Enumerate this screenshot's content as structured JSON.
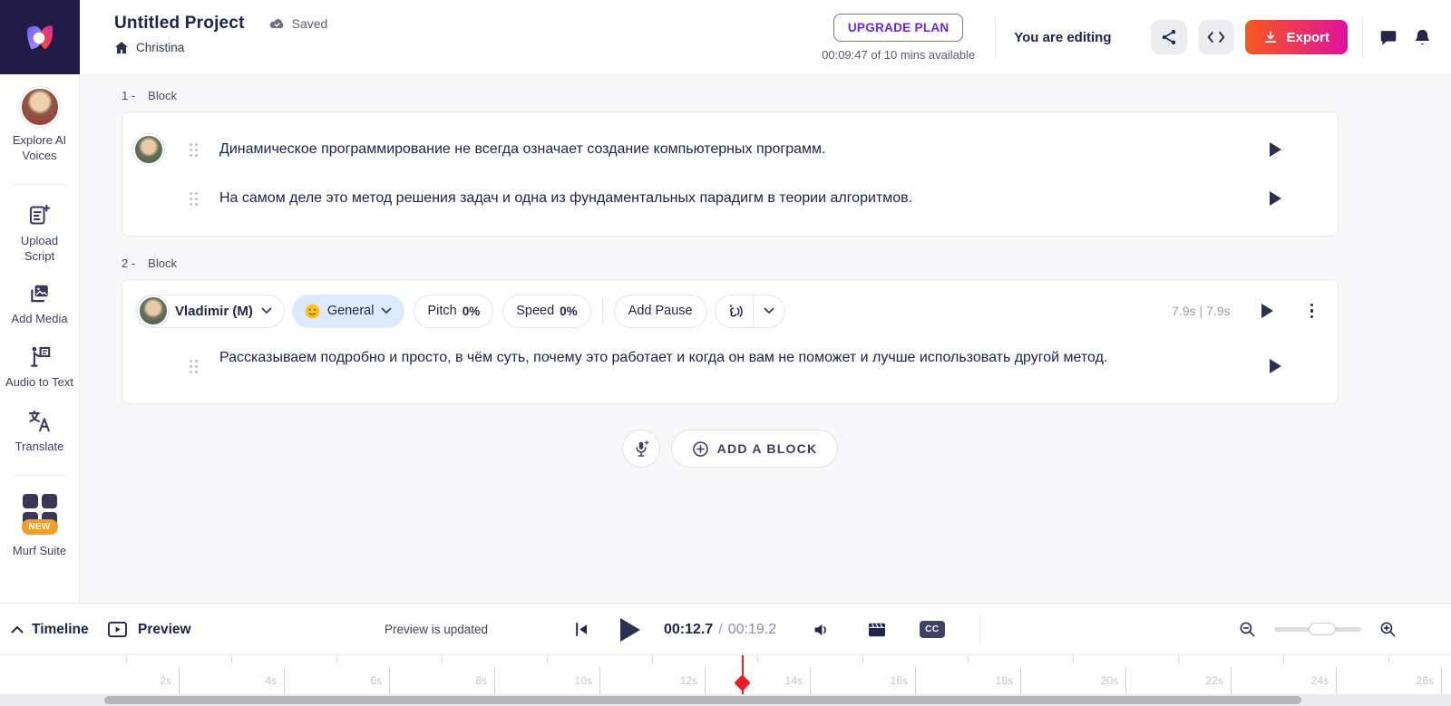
{
  "colors": {
    "accent_purple": "#6d28d9",
    "export_gradient_start": "#f75a1d",
    "export_gradient_end": "#e0119e",
    "playhead_red": "#ed1c24",
    "mood_pill_bg": "#dde9fc",
    "new_badge_orange": "#f0a028",
    "logo_bg": "#221a47"
  },
  "header": {
    "project_title": "Untitled Project",
    "saved_label": "Saved",
    "breadcrumb": "Christina",
    "upgrade_plan_label": "UPGRADE PLAN",
    "minutes_available": "00:09:47 of 10 mins available",
    "editing_status": "You are editing",
    "export_label": "Export"
  },
  "sidebar": {
    "items": [
      {
        "label": "Explore AI Voices"
      },
      {
        "label": "Upload Script"
      },
      {
        "label": "Add Media"
      },
      {
        "label": "Audio to Text"
      },
      {
        "label": "Translate"
      },
      {
        "label": "Murf Suite",
        "badge": "NEW"
      }
    ]
  },
  "blocks": [
    {
      "number": "1 -",
      "type": "Block",
      "lines": [
        {
          "text": "Динамическое программирование не всегда означает создание компьютерных программ."
        },
        {
          "text": "На самом деле это метод решения задач и одна из фундаментальных парадигм в теории алгоритмов."
        }
      ]
    },
    {
      "number": "2 -",
      "type": "Block",
      "voice": {
        "name": "Vladimir (M)",
        "mood": "General",
        "pitch_label": "Pitch",
        "pitch_value": "0%",
        "speed_label": "Speed",
        "speed_value": "0%",
        "add_pause_label": "Add Pause",
        "duration": "7.9s | 7.9s"
      },
      "lines": [
        {
          "text": "Рассказываем подробно и просто, в чём суть, почему это работает и когда он вам не поможет и лучше использовать другой метод."
        }
      ]
    }
  ],
  "composer": {
    "add_block_label": "ADD A BLOCK"
  },
  "playbar": {
    "timeline_label": "Timeline",
    "preview_label": "Preview",
    "preview_status": "Preview is updated",
    "current_time": "00:12.7",
    "separator": "/",
    "total_time": "00:19.2",
    "cc_label": "CC"
  },
  "timeline": {
    "ruler_labels": [
      "2s",
      "4s",
      "6s",
      "8s",
      "10s",
      "12s",
      "14s",
      "16s",
      "18s",
      "20s",
      "22s",
      "24s",
      "26s"
    ],
    "seconds_max": 26,
    "playhead_seconds": 12.7
  }
}
